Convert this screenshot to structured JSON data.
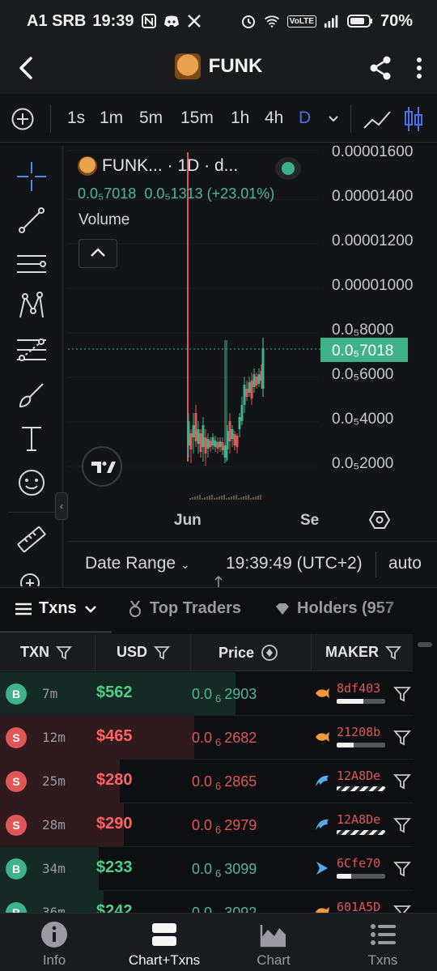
{
  "status_bar": {
    "carrier": "A1 SRB",
    "time": "19:39",
    "battery": "70%",
    "volte": "VoLTE"
  },
  "header": {
    "title": "FUNK"
  },
  "timeframes": {
    "items": [
      "1s",
      "1m",
      "5m",
      "15m",
      "1h",
      "4h",
      "D"
    ],
    "active": "D"
  },
  "chart_legend": {
    "symbol": "FUNK...",
    "interval": "· 1D · d...",
    "open": "0.0₅7018",
    "close": "0.0₅1313",
    "change": "(+23.01%)",
    "volume_label": "Volume"
  },
  "chart_data": {
    "type": "candlestick",
    "y_ticks": [
      "0.00001600",
      "0.00001400",
      "0.00001200",
      "0.00001000",
      "0.0₅8000",
      "0.0₅6000",
      "0.0₅4000",
      "0.0₅2000"
    ],
    "current_price": "0.0₅7018",
    "x_ticks": [
      "Jun",
      "Se"
    ],
    "colors": {
      "up": "#3fb28b",
      "down": "#e05757"
    }
  },
  "date_range": {
    "label": "Date Range",
    "time": "19:39:49 (UTC+2)",
    "scale": "auto"
  },
  "tabs": {
    "txns": "Txns",
    "top_traders": "Top Traders",
    "holders": "Holders (957"
  },
  "table": {
    "headers": {
      "txn": "TXN",
      "usd": "USD",
      "price": "Price",
      "maker": "MAKER"
    },
    "rows": [
      {
        "type": "B",
        "age": "7m",
        "usd": "$562",
        "price_lead": "0.0",
        "price_sub": "6",
        "price_tail": "2903",
        "maker": "8df403",
        "maker_icon": "fish-orange",
        "bar": 0.55,
        "striped": false,
        "bg": 0.57
      },
      {
        "type": "S",
        "age": "12m",
        "usd": "$465",
        "price_lead": "0.0",
        "price_sub": "6",
        "price_tail": "2682",
        "maker": "21208b",
        "maker_icon": "fish-orange",
        "bar": 0.35,
        "striped": false,
        "bg": 0.47
      },
      {
        "type": "S",
        "age": "25m",
        "usd": "$280",
        "price_lead": "0.0",
        "price_sub": "6",
        "price_tail": "2865",
        "maker": "12A8De",
        "maker_icon": "dolphin-blue",
        "bar": 1.0,
        "striped": true,
        "bg": 0.29
      },
      {
        "type": "S",
        "age": "28m",
        "usd": "$290",
        "price_lead": "0.0",
        "price_sub": "6",
        "price_tail": "2979",
        "maker": "12A8De",
        "maker_icon": "dolphin-blue",
        "bar": 1.0,
        "striped": true,
        "bg": 0.3
      },
      {
        "type": "B",
        "age": "34m",
        "usd": "$233",
        "price_lead": "0.0",
        "price_sub": "6",
        "price_tail": "3099",
        "maker": "6Cfe70",
        "maker_icon": "shark-blue",
        "bar": 0.3,
        "striped": false,
        "bg": 0.24
      },
      {
        "type": "B",
        "age": "36m",
        "usd": "$242",
        "price_lead": "0.0",
        "price_sub": "6",
        "price_tail": "3092",
        "maker": "601A5D",
        "maker_icon": "fish-orange",
        "bar": 0.5,
        "striped": false,
        "bg": 0.25
      }
    ]
  },
  "bottom_nav": {
    "info": "Info",
    "chart_txns": "Chart+Txns",
    "chart": "Chart",
    "txns": "Txns"
  }
}
